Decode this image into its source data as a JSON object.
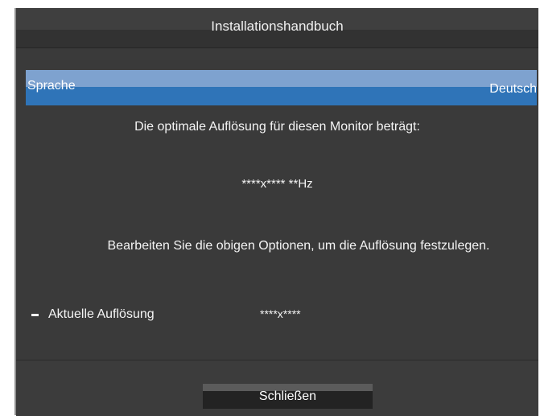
{
  "window": {
    "title": "Installationshandbuch"
  },
  "language": {
    "label": "Sprache",
    "value": "Deutsch"
  },
  "messages": {
    "optimal_resolution": "Die optimale Auflösung für diesen Monitor beträgt:",
    "optimal_value": "****x**** **Hz",
    "instruction": "Bearbeiten Sie die obigen Optionen, um die Auflösung festzulegen."
  },
  "current_resolution": {
    "label": "Aktuelle Auflösung",
    "value": "****x****"
  },
  "footer": {
    "close_label": "Schließen"
  },
  "colors": {
    "background": "#3a3a3a",
    "highlight": "#2f74b8",
    "highlight_top": "#7ea2cf",
    "text": "#f4f4f4"
  }
}
